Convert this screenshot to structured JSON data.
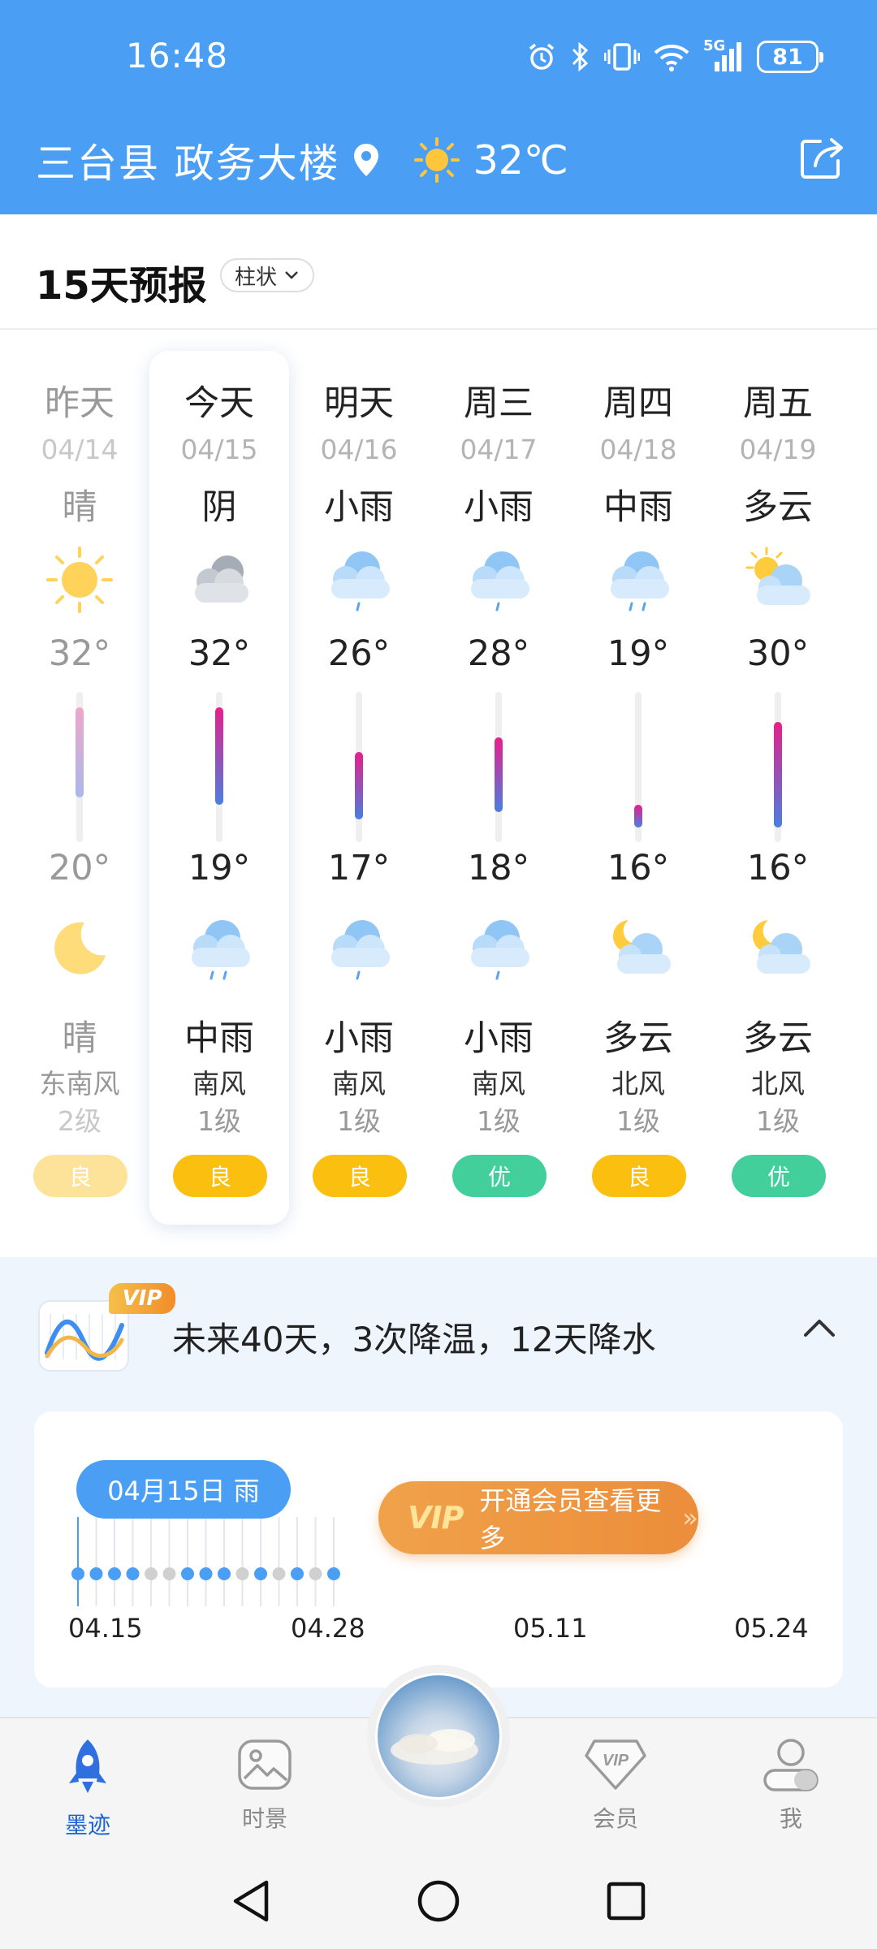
{
  "status_bar": {
    "time": "16:48",
    "network": "5G",
    "battery": "81"
  },
  "header": {
    "location": "三台县 政务大楼",
    "current_temp": "32℃",
    "colors": {
      "header_bg": "#4a9ff5"
    }
  },
  "forecast": {
    "title": "15天预报",
    "mode": "柱状",
    "days": [
      {
        "name": "昨天",
        "date": "04/14",
        "day_cond": "晴",
        "day_icon": "sun-icon",
        "high": "32°",
        "low": "20°",
        "night_icon": "moon-icon",
        "night_cond": "晴",
        "wind": "东南风",
        "wind_level": "2级",
        "aqi": "良",
        "high_value": 32,
        "low_value": 20
      },
      {
        "name": "今天",
        "date": "04/15",
        "day_cond": "阴",
        "day_icon": "overcast-cloud-icon",
        "high": "32°",
        "low": "19°",
        "night_icon": "moderate-rain-icon",
        "night_cond": "中雨",
        "wind": "南风",
        "wind_level": "1级",
        "aqi": "良",
        "high_value": 32,
        "low_value": 19
      },
      {
        "name": "明天",
        "date": "04/16",
        "day_cond": "小雨",
        "day_icon": "light-rain-icon",
        "high": "26°",
        "low": "17°",
        "night_icon": "light-rain-icon",
        "night_cond": "小雨",
        "wind": "南风",
        "wind_level": "1级",
        "aqi": "良",
        "high_value": 26,
        "low_value": 17
      },
      {
        "name": "周三",
        "date": "04/17",
        "day_cond": "小雨",
        "day_icon": "light-rain-icon",
        "high": "28°",
        "low": "18°",
        "night_icon": "light-rain-icon",
        "night_cond": "小雨",
        "wind": "南风",
        "wind_level": "1级",
        "aqi": "优",
        "high_value": 28,
        "low_value": 18
      },
      {
        "name": "周四",
        "date": "04/18",
        "day_cond": "中雨",
        "day_icon": "moderate-rain-icon",
        "high": "19°",
        "low": "16°",
        "night_icon": "partly-cloudy-night-icon",
        "night_cond": "多云",
        "wind": "北风",
        "wind_level": "1级",
        "aqi": "良",
        "high_value": 19,
        "low_value": 16
      },
      {
        "name": "周五",
        "date": "04/19",
        "day_cond": "多云",
        "day_icon": "partly-cloudy-day-icon",
        "high": "30°",
        "low": "16°",
        "night_icon": "partly-cloudy-night-icon",
        "night_cond": "多云",
        "wind": "北风",
        "wind_level": "1级",
        "aqi": "优",
        "high_value": 30,
        "low_value": 16
      }
    ],
    "aqi_colors": {
      "良": "#fbbf0f",
      "优": "#43cf9c"
    }
  },
  "outlook": {
    "vip_tag": "VIP",
    "summary": "未来40天，3次降温，12天降水",
    "bubble": "04月15日 雨",
    "vip_logo": "VIP",
    "vip_button": "开通会员查看更多",
    "ticks": [
      "04.15",
      "04.28",
      "05.11",
      "05.24"
    ]
  },
  "bottom_nav": {
    "items": [
      {
        "label": "墨迹",
        "icon": "rocket-icon",
        "active": true
      },
      {
        "label": "时景",
        "icon": "picture-icon",
        "active": false
      },
      {
        "label": "会员",
        "icon": "vip-diamond-icon",
        "active": false
      },
      {
        "label": "我",
        "icon": "person-icon",
        "active": false
      }
    ]
  }
}
